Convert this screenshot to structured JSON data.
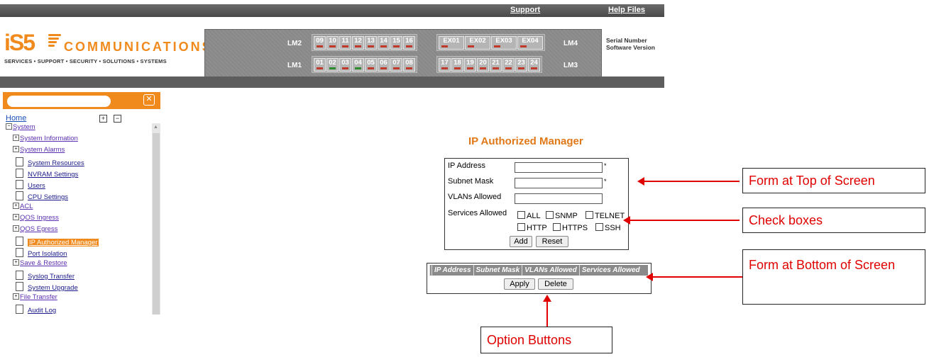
{
  "header": {
    "support_label": "Support",
    "help_label": "Help Files",
    "logo_brand": "iS5",
    "logo_word": "COMMUNICATIONS",
    "logo_tagline": "SERVICES • SUPPORT • SECURITY • SOLUTIONS • SYSTEMS",
    "serial_label": "Serial Number",
    "software_label": "Software Version",
    "brand_color": "#f08a1c"
  },
  "ports": {
    "lm2_label": "LM2",
    "lm1_label": "LM1",
    "lm4_label": "LM4",
    "lm3_label": "LM3",
    "lm2": [
      "09",
      "10",
      "11",
      "12",
      "13",
      "14",
      "15",
      "16"
    ],
    "lm4": [
      "EX01",
      "EX02",
      "EX03",
      "EX04"
    ],
    "lm1": [
      "01",
      "02",
      "03",
      "04",
      "05",
      "06",
      "07",
      "08"
    ],
    "lm3": [
      "17",
      "18",
      "19",
      "20",
      "21",
      "22",
      "23",
      "24"
    ],
    "lm1_led": [
      "red",
      "green",
      "red",
      "green",
      "red",
      "red",
      "red",
      "red"
    ]
  },
  "sidebar": {
    "home_label": "Home",
    "tree": [
      {
        "label": "System",
        "kind": "folder"
      },
      {
        "label": "System Information",
        "kind": "folder"
      },
      {
        "label": "System Alarms",
        "kind": "folder"
      },
      {
        "label": "System Resources",
        "kind": "leaf"
      },
      {
        "label": "NVRAM Settings",
        "kind": "leaf"
      },
      {
        "label": "Users",
        "kind": "leaf"
      },
      {
        "label": "CPU Settings",
        "kind": "leaf"
      },
      {
        "label": "ACL",
        "kind": "folder"
      },
      {
        "label": "QOS Ingress",
        "kind": "folder"
      },
      {
        "label": "QOS Egress",
        "kind": "folder"
      },
      {
        "label": "IP Authorized Manager",
        "kind": "leaf",
        "selected": true
      },
      {
        "label": "Port Isolation",
        "kind": "leaf"
      },
      {
        "label": "Save & Restore",
        "kind": "folder"
      },
      {
        "label": "Syslog Transfer",
        "kind": "leaf"
      },
      {
        "label": "System Upgrade",
        "kind": "leaf"
      },
      {
        "label": "File Transfer",
        "kind": "folder"
      },
      {
        "label": "Audit Log",
        "kind": "leaf"
      }
    ]
  },
  "form": {
    "title": "IP Authorized Manager",
    "ip_label": "IP Address",
    "mask_label": "Subnet Mask",
    "vlans_label": "VLANs Allowed",
    "services_label": "Services Allowed",
    "required_mark": "*",
    "services": [
      "ALL",
      "SNMP",
      "TELNET",
      "HTTP",
      "HTTPS",
      "SSH"
    ],
    "add_label": "Add",
    "reset_label": "Reset"
  },
  "table": {
    "columns": [
      "IP Address",
      "Subnet Mask",
      "VLANs Allowed",
      "Services Allowed"
    ],
    "apply_label": "Apply",
    "delete_label": "Delete"
  },
  "annotations": {
    "form_top": "Form at Top of Screen",
    "check_boxes": "Check boxes",
    "form_bottom": "Form at Bottom of Screen",
    "option_buttons": "Option Buttons",
    "annotation_color": "#e00000"
  }
}
